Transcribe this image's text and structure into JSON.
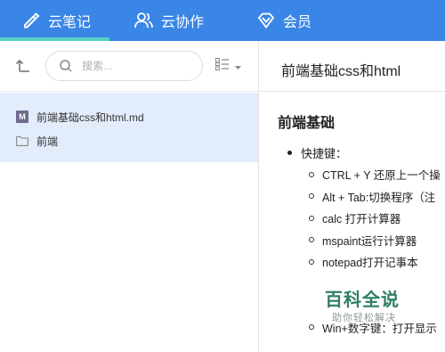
{
  "nav": {
    "tabs": [
      {
        "label": "云笔记",
        "icon": "pencil-icon",
        "active": true
      },
      {
        "label": "云协作",
        "icon": "users-icon",
        "active": false
      },
      {
        "label": "会员",
        "icon": "diamond-icon",
        "active": false
      }
    ],
    "colors": {
      "bar": "#3a86e6",
      "active_underline": "#57d2c2"
    }
  },
  "sidebar": {
    "search_placeholder": "搜索...",
    "files": [
      {
        "name": "前端基础css和html.md",
        "icon": "markdown-icon",
        "badge": "M",
        "folder": "前端",
        "selected": true
      }
    ]
  },
  "document": {
    "title": "前端基础css和html",
    "heading": "前端基础",
    "bullet": "快捷键：",
    "items": [
      "CTRL + Y 还原上一个操",
      "Alt + Tab:切换程序（注",
      "calc 打开计算器",
      "mspaint运行计算器",
      "notepad打开记事本",
      "",
      "",
      "Win+数字键：打开显示"
    ]
  },
  "watermark": {
    "main": "百科全说",
    "sub": "助你轻松解决"
  }
}
